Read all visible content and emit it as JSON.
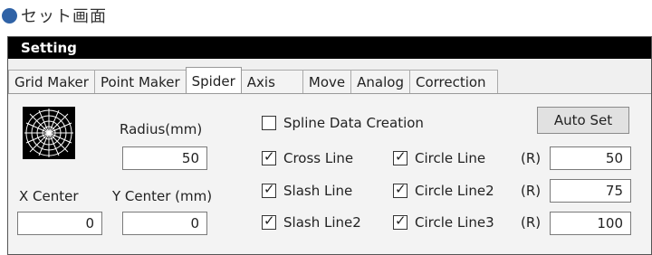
{
  "heading": {
    "text": "セット画面"
  },
  "window": {
    "title": "Setting"
  },
  "tabs": [
    {
      "label": "Grid Maker"
    },
    {
      "label": "Point Maker"
    },
    {
      "label": "Spider"
    },
    {
      "label": "Axis"
    },
    {
      "label": "Move"
    },
    {
      "label": "Analog"
    },
    {
      "label": "Correction"
    }
  ],
  "spider": {
    "radius_label": "Radius(mm)",
    "radius_value": "50",
    "x_center_label": "X Center",
    "y_center_label": "Y Center (mm)",
    "x_center_value": "0",
    "y_center_value": "0",
    "spline_label": "Spline Data Creation",
    "auto_set_label": "Auto Set",
    "cross_line_label": "Cross Line",
    "slash_line_label": "Slash Line",
    "slash_line2_label": "Slash Line2",
    "circle_line_label": "Circle Line",
    "circle_line2_label": "Circle Line2",
    "circle_line3_label": "Circle Line3",
    "r_label": "(R)",
    "circle_line_value": "50",
    "circle_line2_value": "75",
    "circle_line3_value": "100",
    "checkbox_states": {
      "spline": false,
      "cross_line": true,
      "slash_line": true,
      "slash_line2": true,
      "circle_line": true,
      "circle_line2": true,
      "circle_line3": true
    }
  }
}
